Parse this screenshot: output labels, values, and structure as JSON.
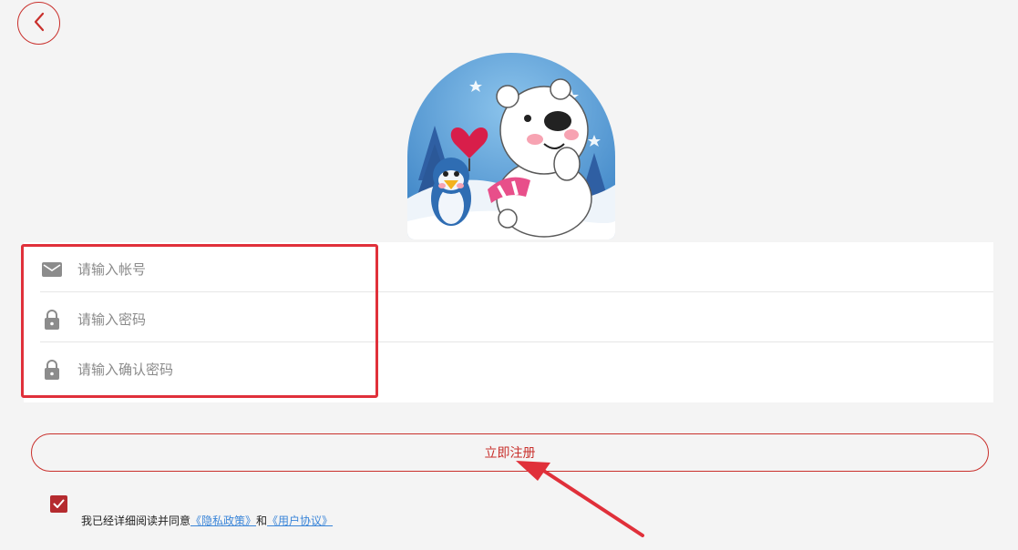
{
  "form": {
    "account_placeholder": "请输入帐号",
    "password_placeholder": "请输入密码",
    "confirm_placeholder": "请输入确认密码"
  },
  "register_button": "立即注册",
  "agreement": {
    "prefix": "我已经详细阅读并同意",
    "privacy_link": "《隐私政策》",
    "and": "和",
    "user_link": "《用户协议》",
    "checked": true
  },
  "colors": {
    "accent": "#c9302c",
    "highlight": "#e0303a",
    "link": "#3a85d8",
    "background": "#f4f4f4"
  },
  "icons": {
    "back": "chevron-left-icon",
    "account": "mail-icon",
    "password": "lock-icon",
    "confirm": "lock-icon",
    "checkbox": "check-icon"
  }
}
